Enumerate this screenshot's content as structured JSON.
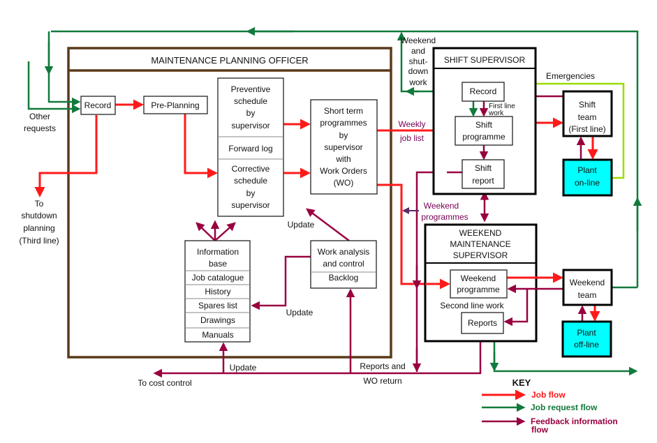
{
  "colors": {
    "job_flow": "#ff1a1a",
    "job_request_flow": "#117a3c",
    "feedback_flow": "#990040",
    "planning_officer_border": "#5a3a1a",
    "plant": "#00ffff",
    "emergency": "#99dd00"
  },
  "mpo": {
    "title": "MAINTENANCE PLANNING OFFICER",
    "record": "Record",
    "pre_planning": "Pre-Planning",
    "preventive": [
      "Preventive",
      "schedule",
      "by",
      "supervisor"
    ],
    "forward_log": "Forward log",
    "corrective": [
      "Corrective",
      "schedule",
      "by",
      "supervisor"
    ],
    "short_term": [
      "Short term",
      "programmes",
      "by",
      "supervisor",
      "with",
      "Work Orders",
      "(WO)"
    ],
    "info_base": [
      "Information",
      "base"
    ],
    "info_items": [
      "Job catalogue",
      "History",
      "Spares list",
      "Drawings",
      "Manuals"
    ],
    "work_analysis": [
      "Work analysis",
      "and control"
    ],
    "backlog": "Backlog"
  },
  "shift": {
    "title": "SHIFT SUPERVISOR",
    "record": "Record",
    "first_line_work": [
      "First line",
      "work"
    ],
    "programme": [
      "Shift",
      "programme"
    ],
    "report": [
      "Shift",
      "report"
    ],
    "team": [
      "Shift",
      "team",
      "(First line)"
    ],
    "plant": [
      "Plant",
      "on-line"
    ],
    "emergencies": "Emergencies"
  },
  "weekend": {
    "title": [
      "WEEKEND",
      "MAINTENANCE",
      "SUPERVISOR"
    ],
    "programme": [
      "Weekend",
      "programme"
    ],
    "second_line": "Second line work",
    "reports": "Reports",
    "team": [
      "Weekend",
      "team"
    ],
    "plant": [
      "Plant",
      "off-line"
    ]
  },
  "labels": {
    "other_requests": [
      "Other",
      "requests"
    ],
    "shutdown": [
      "To",
      "shutdown",
      "planning",
      "(Third line)"
    ],
    "weekend_shutdown": [
      "Weekend",
      "and",
      "shut-",
      "down",
      "work"
    ],
    "weekly_job_list": [
      "Weekly",
      "job list"
    ],
    "weekend_programmes": [
      "Weekend",
      "programmes"
    ],
    "update": "Update",
    "reports_wo": [
      "Reports and",
      "WO return"
    ],
    "cost_control": "To cost control"
  },
  "key": {
    "title": "KEY",
    "job_flow": "Job  flow",
    "job_request_flow": "Job request flow",
    "feedback": [
      "Feedback information",
      "flow"
    ]
  }
}
